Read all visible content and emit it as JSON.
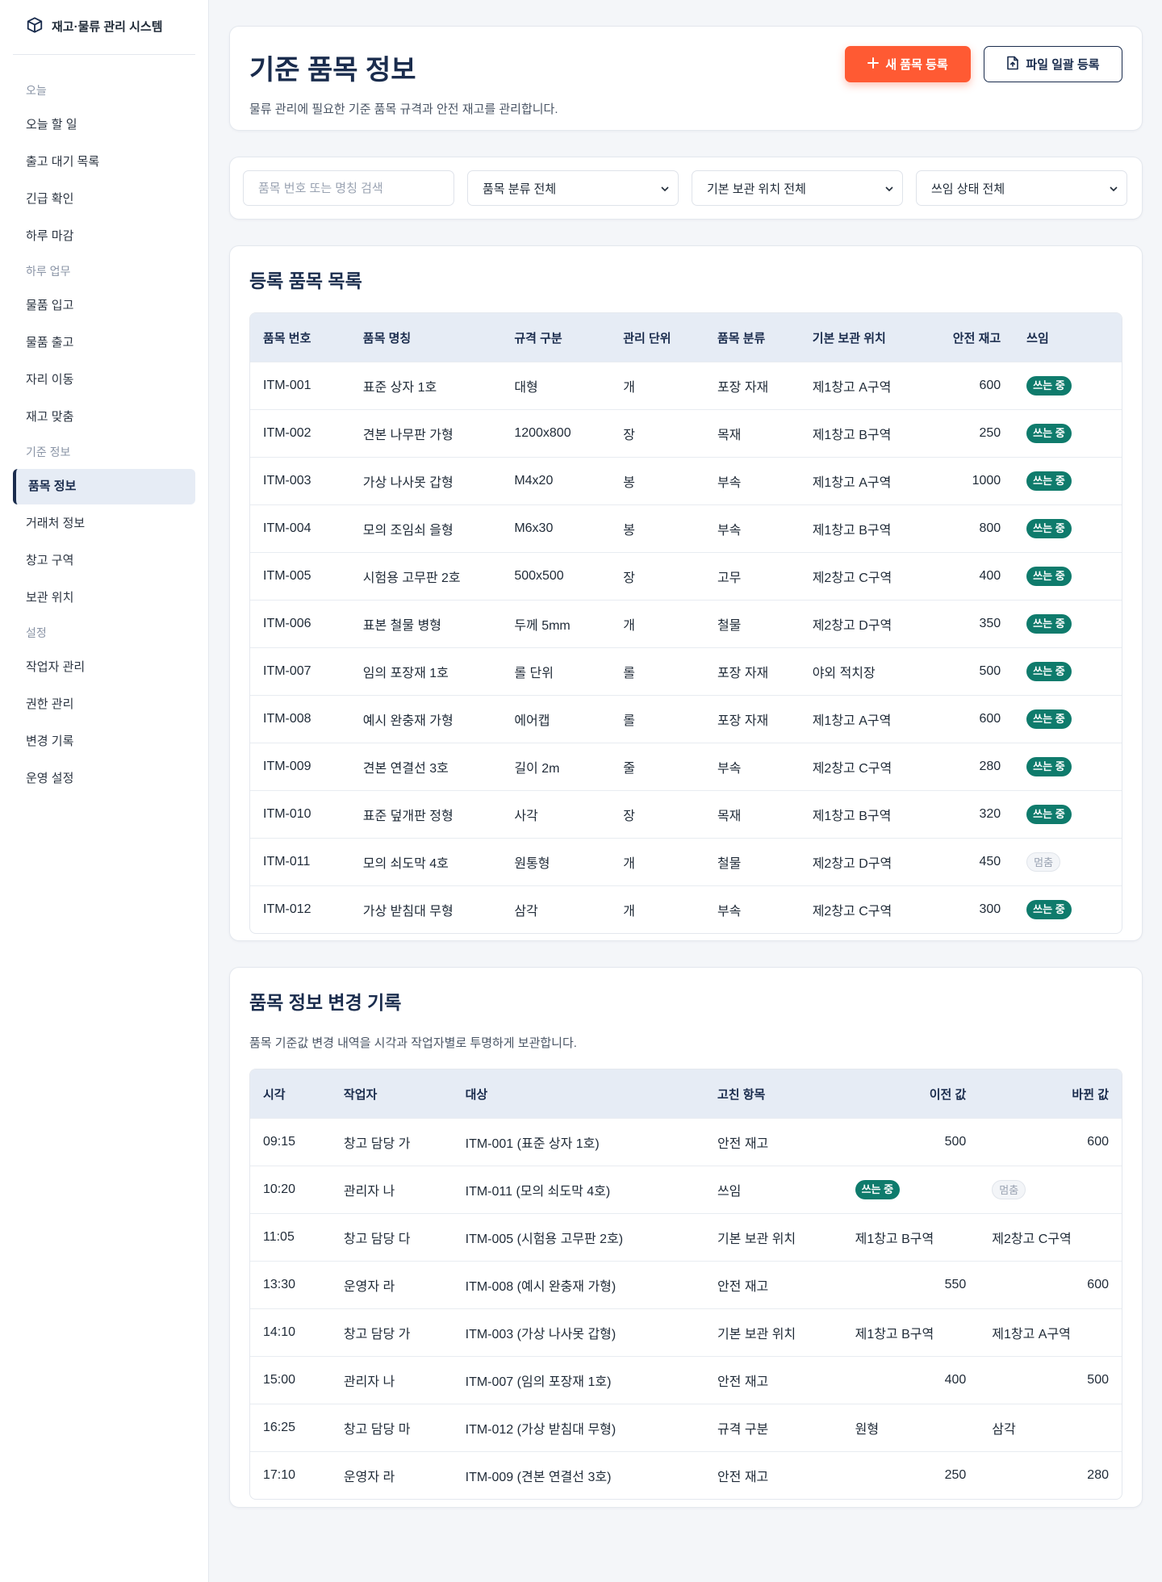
{
  "sidebar": {
    "brand": "재고·물류 관리 시스템",
    "brand_icon": "box-icon",
    "sections": [
      {
        "title": "오늘",
        "items": [
          "오늘 할 일",
          "출고 대기 목록",
          "긴급 확인",
          "하루 마감"
        ]
      },
      {
        "title": "하루 업무",
        "items": [
          "물품 입고",
          "물품 출고",
          "자리 이동",
          "재고 맞춤"
        ]
      },
      {
        "title": "기준 정보",
        "items": [
          "품목 정보",
          "거래처 정보",
          "창고 구역",
          "보관 위치"
        ]
      },
      {
        "title": "설정",
        "items": [
          "작업자 관리",
          "권한 관리",
          "변경 기록",
          "운영 설정"
        ]
      }
    ],
    "active_item": "품목 정보"
  },
  "header": {
    "title": "기준 품목 정보",
    "description": "물류 관리에 필요한 기준 품목 규격과 안전 재고를 관리합니다.",
    "new_button": "새 품목 등록",
    "upload_button": "파일 일괄 등록"
  },
  "filters": {
    "search_placeholder": "품목 번호 또는 명칭 검색",
    "category": "품목 분류 전체",
    "location": "기본 보관 위치 전체",
    "status": "쓰임 상태 전체"
  },
  "items": {
    "title": "등록 품목 목록",
    "columns": [
      "품목 번호",
      "품목 명칭",
      "규격 구분",
      "관리 단위",
      "품목 분류",
      "기본 보관 위치",
      "안전 재고",
      "쓰임"
    ],
    "rows": [
      [
        "ITM-001",
        "표준 상자 1호",
        "대형",
        "개",
        "포장 자재",
        "제1창고 A구역",
        "600",
        "쓰는 중"
      ],
      [
        "ITM-002",
        "견본 나무판 가형",
        "1200x800",
        "장",
        "목재",
        "제1창고 B구역",
        "250",
        "쓰는 중"
      ],
      [
        "ITM-003",
        "가상 나사못 갑형",
        "M4x20",
        "봉",
        "부속",
        "제1창고 A구역",
        "1000",
        "쓰는 중"
      ],
      [
        "ITM-004",
        "모의 조임쇠 을형",
        "M6x30",
        "봉",
        "부속",
        "제1창고 B구역",
        "800",
        "쓰는 중"
      ],
      [
        "ITM-005",
        "시험용 고무판 2호",
        "500x500",
        "장",
        "고무",
        "제2창고 C구역",
        "400",
        "쓰는 중"
      ],
      [
        "ITM-006",
        "표본 철물 병형",
        "두께 5mm",
        "개",
        "철물",
        "제2창고 D구역",
        "350",
        "쓰는 중"
      ],
      [
        "ITM-007",
        "임의 포장재 1호",
        "롤 단위",
        "롤",
        "포장 자재",
        "야외 적치장",
        "500",
        "쓰는 중"
      ],
      [
        "ITM-008",
        "예시 완충재 가형",
        "에어캡",
        "롤",
        "포장 자재",
        "제1창고 A구역",
        "600",
        "쓰는 중"
      ],
      [
        "ITM-009",
        "견본 연결선 3호",
        "길이 2m",
        "줄",
        "부속",
        "제2창고 C구역",
        "280",
        "쓰는 중"
      ],
      [
        "ITM-010",
        "표준 덮개판 정형",
        "사각",
        "장",
        "목재",
        "제1창고 B구역",
        "320",
        "쓰는 중"
      ],
      [
        "ITM-011",
        "모의 쇠도막 4호",
        "원통형",
        "개",
        "철물",
        "제2창고 D구역",
        "450",
        "멈춤"
      ],
      [
        "ITM-012",
        "가상 받침대 무형",
        "삼각",
        "개",
        "부속",
        "제2창고 C구역",
        "300",
        "쓰는 중"
      ]
    ]
  },
  "log": {
    "title": "품목 정보 변경 기록",
    "description": "품목 기준값 변경 내역을 시각과 작업자별로 투명하게 보관합니다.",
    "columns": [
      "시각",
      "작업자",
      "대상",
      "고친 항목",
      "이전 값",
      "바뀐 값"
    ],
    "rows": [
      [
        "09:15",
        "창고 담당 가",
        "ITM-001 (표준 상자 1호)",
        "안전 재고",
        "500",
        "600"
      ],
      [
        "10:20",
        "관리자 나",
        "ITM-011 (모의 쇠도막 4호)",
        "쓰임",
        "쓰는 중",
        "멈춤"
      ],
      [
        "11:05",
        "창고 담당 다",
        "ITM-005 (시험용 고무판 2호)",
        "기본 보관 위치",
        "제1창고 B구역",
        "제2창고 C구역"
      ],
      [
        "13:30",
        "운영자 라",
        "ITM-008 (예시 완충재 가형)",
        "안전 재고",
        "550",
        "600"
      ],
      [
        "14:10",
        "창고 담당 가",
        "ITM-003 (가상 나사못 갑형)",
        "기본 보관 위치",
        "제1창고 B구역",
        "제1창고 A구역"
      ],
      [
        "15:00",
        "관리자 나",
        "ITM-007 (임의 포장재 1호)",
        "안전 재고",
        "400",
        "500"
      ],
      [
        "16:25",
        "창고 담당 마",
        "ITM-012 (가상 받침대 무형)",
        "규격 구분",
        "원형",
        "삼각"
      ],
      [
        "17:10",
        "운영자 라",
        "ITM-009 (견본 연결선 3호)",
        "안전 재고",
        "250",
        "280"
      ]
    ]
  },
  "colors": {
    "primary": "#ff5a33",
    "navy": "#1a2c4d",
    "badge_active": "#0f7b6c",
    "header_bg": "#e6ecf5"
  }
}
